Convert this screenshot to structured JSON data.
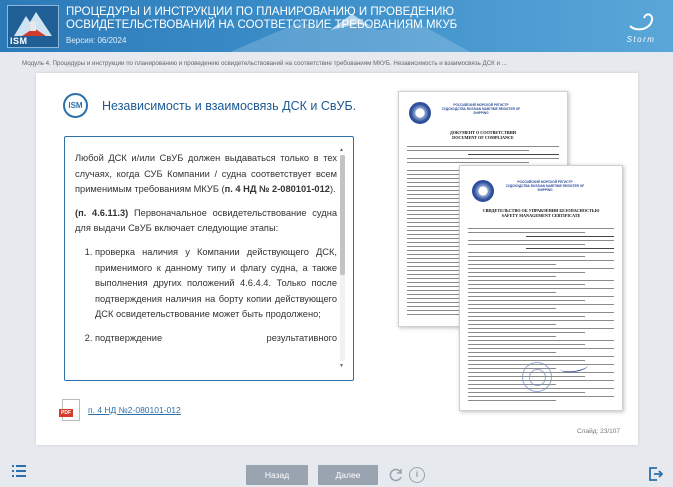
{
  "header": {
    "title": "ПРОЦЕДУРЫ И ИНСТРУКЦИИ ПО ПЛАНИРОВАНИЮ И ПРОВЕДЕНИЮ ОСВИДЕТЕЛЬСТВОВАНИЙ НА СООТВЕТСТВИЕ ТРЕБОВАНИЯМ МКУБ",
    "version": "Версия: 06/2024",
    "logo_text": "ISM",
    "brand_logo_text": "Storm"
  },
  "breadcrumb": "Модуль 4. Процедуры и инструкции по планированию и проведению освидетельствований на соответствие требованиям МКУБ. Независимость и взаимосвязь ДСК и ...",
  "card": {
    "badge": "ISM",
    "title": "Независимость и взаимосвязь ДСК и СвУБ.",
    "para1_text": "Любой ДСК и/или СвУБ должен выдаваться только в тех случаях, когда СУБ Компании / судна соответствует всем применимым требованиям МКУБ (",
    "para1_ref": "п. 4 НД № 2-080101-012",
    "para1_end": ").",
    "para2_ref": "(п. 4.6.11.3)",
    "para2_text": " Первоначальное освидетельствование судна для выдачи СвУБ включает следующие этапы:",
    "list_items": [
      "проверка наличия у Компании действующего ДСК, применимого к данному типу и флагу судна, а также выполнения других положений 4.6.4.4. Только после подтверждения наличия на борту копии действующего ДСК освидетельствование может быть продолжено;",
      "подтверждение результативного"
    ]
  },
  "documents": {
    "doc1": {
      "org": "РОССИЙСКИЙ МОРСКОЙ РЕГИСТР СУДОХОДСТВА RUSSIAN MARITIME REGISTER OF SHIPPING",
      "title_ru": "ДОКУМЕНТ О СООТВЕТСТВИИ",
      "title_en": "DOCUMENT OF COMPLIANCE"
    },
    "doc2": {
      "org": "РОССИЙСКИЙ МОРСКОЙ РЕГИСТР СУДОХОДСТВА RUSSIAN MARITIME REGISTER OF SHIPPING",
      "title_ru": "СВИДЕТЕЛЬСТВО ОБ УПРАВЛЕНИИ БЕЗОПАСНОСТЬЮ",
      "title_en": "SAFETY MANAGEMENT CERTIFICATE"
    }
  },
  "pdf_link": {
    "label": "п. 4 НД №2-080101-012",
    "icon_tag": "PDF"
  },
  "slide_counter": "Слайд: 23/107",
  "nav": {
    "back_label": "Назад",
    "next_label": "Далее",
    "info_label": "i"
  },
  "colors": {
    "accent": "#2d6fa8",
    "header": "#3b8ec9",
    "button": "#9aa4b1"
  },
  "icons": [
    "menu-icon",
    "reload-icon",
    "info-icon",
    "exit-icon",
    "pdf-icon"
  ]
}
